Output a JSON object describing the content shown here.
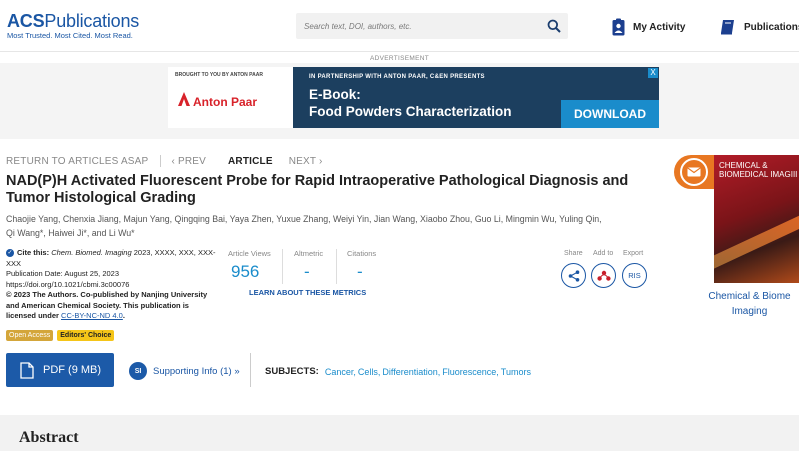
{
  "header": {
    "logo_prefix": "ACS",
    "logo_name": "Publications",
    "logo_tagline": "Most Trusted. Most Cited. Most Read.",
    "search_placeholder": "Search text, DOI, authors, etc.",
    "my_activity": "My Activity",
    "publications": "Publications"
  },
  "ad": {
    "label": "ADVERTISEMENT",
    "brought_by": "BROUGHT TO YOU BY ANTON PAAR",
    "brand": "Anton Paar",
    "partner": "IN PARTNERSHIP WITH ANTON PAAR, C&EN PRESENTS",
    "headline_1": "E-Book:",
    "headline_2": "Food Powders Characterization",
    "download": "DOWNLOAD",
    "close": "X"
  },
  "article_nav": {
    "return": "RETURN TO ARTICLES ASAP",
    "prev": "PREV",
    "current": "ARTICLE",
    "next": "NEXT"
  },
  "article": {
    "title": "NAD(P)H Activated Fluorescent Probe for Rapid Intraoperative Pathological Diagnosis and Tumor Histological Grading",
    "authors_line1": "Chaojie Yang, Chenxia Jiang, Majun Yang, Qingqing Bai, Yaya Zhen, Yuxue Zhang, Weiyi Yin, Jian Wang, Xiaobo Zhou, Guo Li, Mingmin Wu, Yuling Qin,",
    "authors_line2": "Qi Wang*, Haiwei Ji*, and Li Wu*"
  },
  "cite": {
    "cite_label": "Cite this:",
    "journal": "Chem. Biomed. Imaging",
    "ref": "2023, XXXX, XXX, XXX-XXX",
    "pub_date": "Publication Date: August 25, 2023",
    "doi": "https://doi.org/10.1021/cbmi.3c00076",
    "copyright": "© 2023 The Authors. Co-published by Nanjing University and American Chemical Society. This publication is licensed under",
    "license": "CC-BY-NC-ND 4.0",
    "period": ".",
    "badge_oa": "Open Access",
    "badge_ec": "Editors' Choice"
  },
  "metrics": {
    "views_label": "Article Views",
    "views_value": "956",
    "altmetric_label": "Altmetric",
    "altmetric_value": "-",
    "citations_label": "Citations",
    "citations_value": "-",
    "learn": "LEARN ABOUT THESE METRICS"
  },
  "actions": {
    "share": "Share",
    "add_to": "Add to",
    "export": "Export",
    "ris": "RIS"
  },
  "cover": {
    "title_1": "CHEMICAL &",
    "title_2": "BIOMEDICAL IMAGIII",
    "caption_1": "Chemical & Biome",
    "caption_2": "Imaging"
  },
  "bottom": {
    "pdf": "PDF (9 MB)",
    "si_icon": "SI",
    "supporting": "Supporting Info (1) »",
    "subjects_label": "SUBJECTS:",
    "subjects": [
      "Cancer,",
      "Cells,",
      "Differentiation,",
      "Fluorescence,",
      "Tumors"
    ]
  },
  "abstract": "Abstract",
  "colors": {
    "brand_blue": "#1a56a4",
    "metric_blue": "#1a8ccb",
    "pdf_button": "#1c5aa8",
    "orange": "#e87722"
  }
}
